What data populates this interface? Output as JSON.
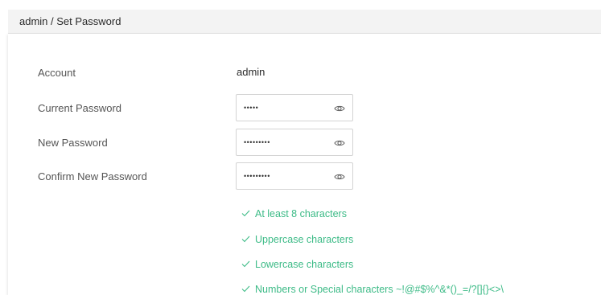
{
  "header": {
    "breadcrumb": "admin / Set Password"
  },
  "form": {
    "account_label": "Account",
    "account_value": "admin",
    "current_password_label": "Current Password",
    "current_password_value": "•••••",
    "new_password_label": "New Password",
    "new_password_value": "•••••••••",
    "confirm_password_label": "Confirm New Password",
    "confirm_password_value": "•••••••••"
  },
  "requirements": [
    "At least 8 characters",
    "Uppercase characters",
    "Lowercase characters",
    "Numbers or Special characters ~!@#$%^&*()_=/?[]{}<>\\"
  ],
  "colors": {
    "requirement_met": "#3dbb87",
    "header_background": "#f3f3f3"
  },
  "icons": {
    "show_password": "eye-icon",
    "requirement_met": "check-icon"
  }
}
